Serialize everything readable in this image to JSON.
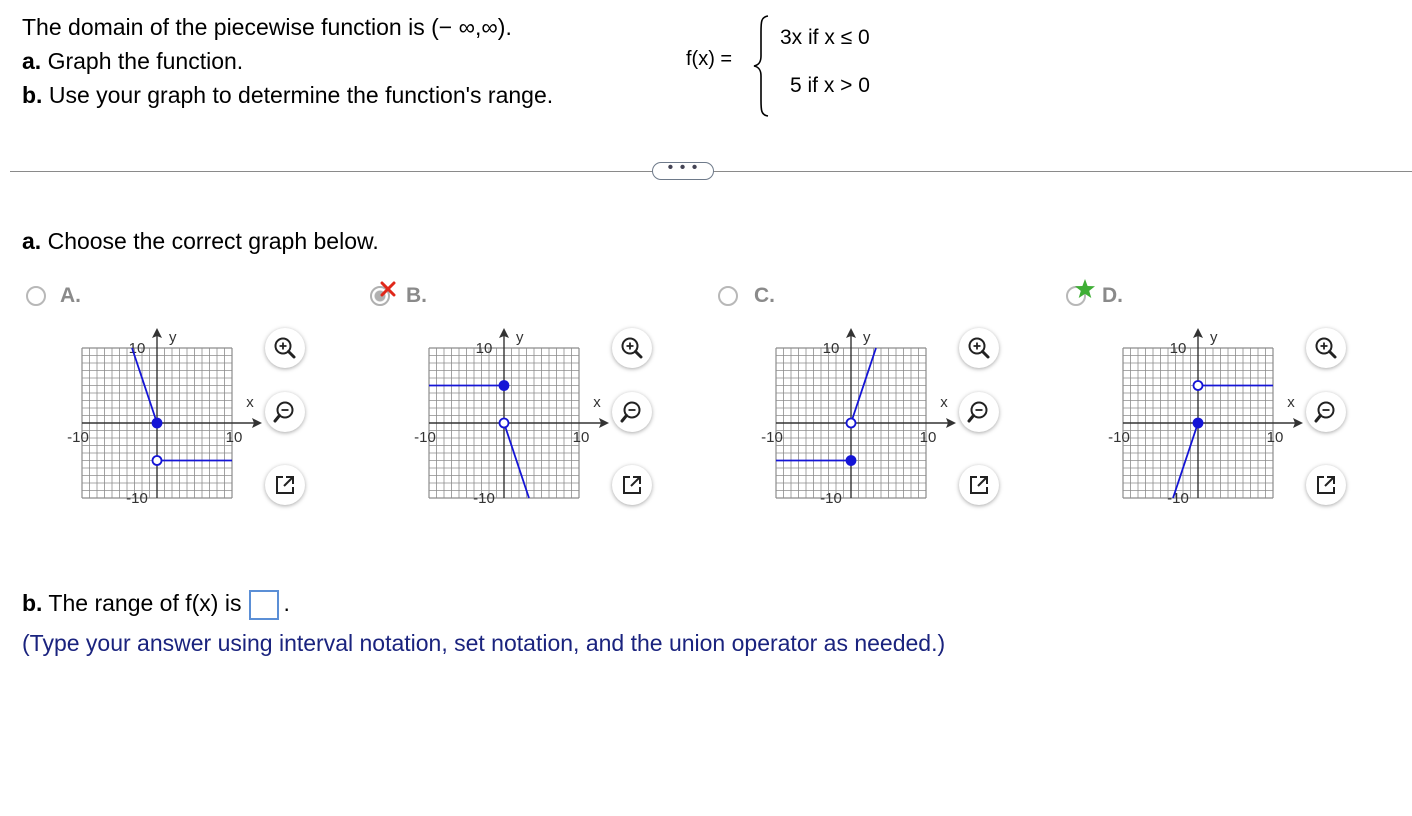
{
  "question": {
    "line1": "The domain of the piecewise function is (− ∞,∞).",
    "line2_bold": "a.",
    "line2": " Graph the function.",
    "line3_bold": "b.",
    "line3": " Use your graph to determine the function's range."
  },
  "function": {
    "label": "f(x) =",
    "case1": "3x  if  x ≤ 0",
    "case2": "5  if  x > 0"
  },
  "more_button": "• • •",
  "part_a": {
    "bold": "a.",
    "text": " Choose the correct graph below."
  },
  "options": [
    {
      "label": "A.",
      "selected": false,
      "mark": "none"
    },
    {
      "label": "B.",
      "selected": true,
      "mark": "incorrect"
    },
    {
      "label": "C.",
      "selected": false,
      "mark": "none"
    },
    {
      "label": "D.",
      "selected": false,
      "mark": "correct"
    }
  ],
  "graph_axes": {
    "x_label": "x",
    "y_label": "y",
    "tick_neg": "-10",
    "tick_pos": "10",
    "xlim": [
      -10,
      10
    ],
    "ylim": [
      -10,
      10
    ]
  },
  "chart_data": [
    {
      "type": "line",
      "option": "A.",
      "segments": [
        {
          "points": [
            [
              -3.33,
              10
            ],
            [
              0,
              0
            ]
          ],
          "end": "closed"
        },
        {
          "points": [
            [
              0,
              -5
            ],
            [
              10,
              -5
            ]
          ],
          "start": "open"
        }
      ]
    },
    {
      "type": "line",
      "option": "B.",
      "segments": [
        {
          "points": [
            [
              -10,
              5
            ],
            [
              0,
              5
            ]
          ],
          "end": "closed"
        },
        {
          "points": [
            [
              0,
              0
            ],
            [
              3.33,
              -10
            ]
          ],
          "start": "open"
        }
      ]
    },
    {
      "type": "line",
      "option": "C.",
      "segments": [
        {
          "points": [
            [
              -10,
              -5
            ],
            [
              0,
              -5
            ]
          ],
          "end": "closed"
        },
        {
          "points": [
            [
              0,
              0
            ],
            [
              3.33,
              10
            ]
          ],
          "start": "open"
        }
      ]
    },
    {
      "type": "line",
      "option": "D.",
      "segments": [
        {
          "points": [
            [
              -3.33,
              -10
            ],
            [
              0,
              0
            ]
          ],
          "end": "closed"
        },
        {
          "points": [
            [
              0,
              5
            ],
            [
              10,
              5
            ]
          ],
          "start": "open"
        }
      ]
    }
  ],
  "tools": {
    "zoom_in": "zoom-in-icon",
    "zoom_out": "zoom-out-icon",
    "expand": "expand-icon"
  },
  "part_b": {
    "bold": "b.",
    "text": " The range of f(x) is",
    "answer": "",
    "period": "."
  },
  "hint": "(Type your answer using interval notation, set notation, and the union operator as needed.)",
  "colors": {
    "graph_line": "#1515d6",
    "grid": "#8c8c8c",
    "incorrect": "#e0281a",
    "correct": "#3fae35",
    "hint_text": "#1a237e",
    "answer_border": "#5b8fd6"
  }
}
